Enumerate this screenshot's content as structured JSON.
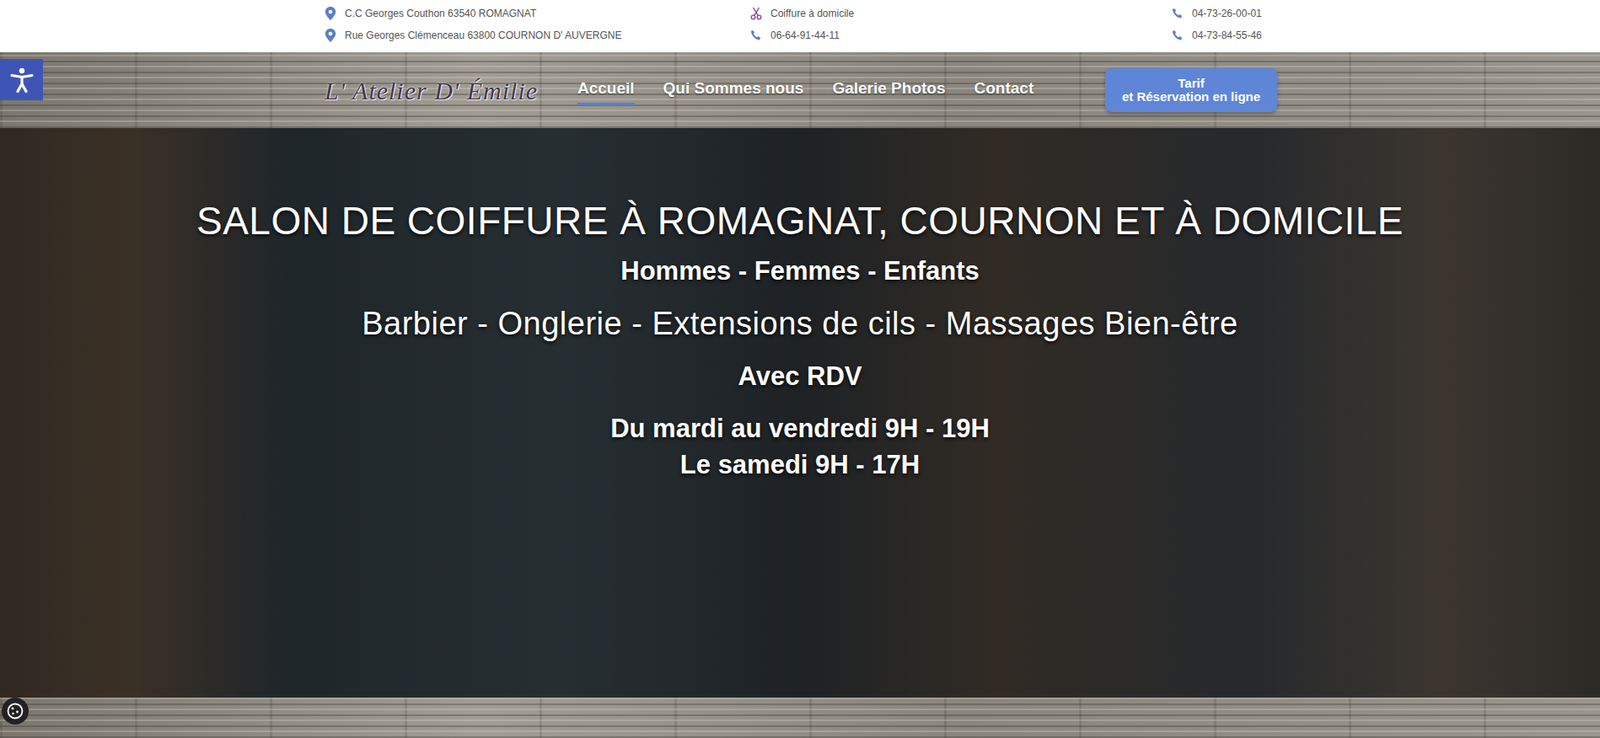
{
  "topbar": {
    "columns": [
      {
        "items": [
          {
            "kind": "pin",
            "text": "C.C Georges Couthon 63540 ROMAGNAT"
          },
          {
            "kind": "pin",
            "text": "Rue Georges Clémenceau 63800 COURNON D' AUVERGNE"
          }
        ]
      },
      {
        "items": [
          {
            "kind": "scissors",
            "text": "Coiffure à domicile"
          },
          {
            "kind": "phone",
            "text": "06-64-91-44-11"
          }
        ]
      },
      {
        "items": [
          {
            "kind": "phone",
            "text": "04-73-26-00-01"
          },
          {
            "kind": "phone",
            "text": "04-73-84-55-46"
          }
        ]
      }
    ]
  },
  "logo": "L' Atelier D' Émilie",
  "nav": [
    {
      "label": "Accueil",
      "selected": true
    },
    {
      "label": "Qui Sommes nous",
      "selected": false
    },
    {
      "label": "Galerie Photos",
      "selected": false
    },
    {
      "label": "Contact",
      "selected": false
    }
  ],
  "booking_button": {
    "line1": "Tarif",
    "line2": "et Réservation en ligne"
  },
  "hero": {
    "title": "SALON DE COIFFURE À ROMAGNAT, COURNON ET À DOMICILE",
    "audience": "Hommes - Femmes - Enfants",
    "services": "Barbier - Onglerie - Extensions de cils - Massages Bien-être",
    "appointment": "Avec RDV",
    "hours": [
      "Du mardi au vendredi 9H - 19H",
      "Le samedi 9H - 17H"
    ]
  }
}
